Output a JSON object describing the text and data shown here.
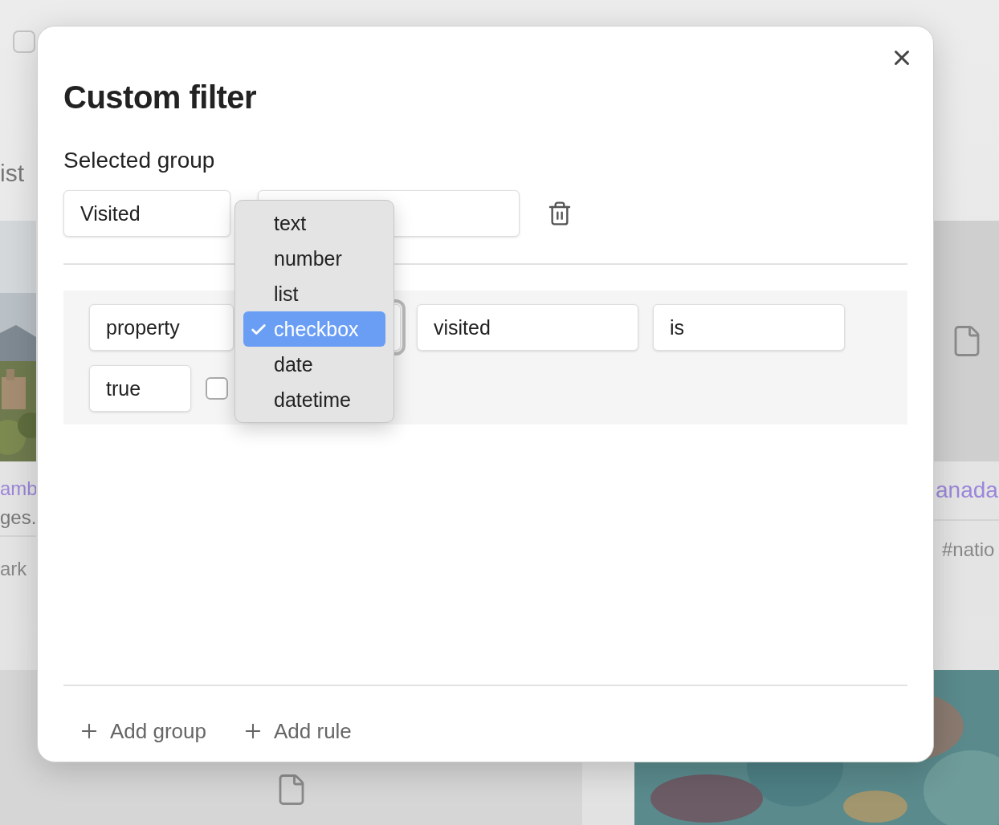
{
  "background": {
    "checkbox": {
      "checked": false
    },
    "header_text": "ist",
    "cards": [
      {
        "kind": "picture",
        "title": "amb",
        "description": "ges.",
        "tag": "ark"
      },
      {
        "kind": "file",
        "title": "anada",
        "tag": "#natio"
      }
    ],
    "bottom_cards": [
      {
        "kind": "file"
      },
      {
        "kind": "picture"
      }
    ]
  },
  "dialog": {
    "title": "Custom filter",
    "section_label": "Selected group",
    "group": {
      "name": "Visited"
    },
    "rule": {
      "source": "property",
      "type_focused": true,
      "property": "visited",
      "operator": "is",
      "value": "true",
      "checked": false
    },
    "type_menu": [
      {
        "label": "text",
        "selected": false
      },
      {
        "label": "number",
        "selected": false
      },
      {
        "label": "list",
        "selected": false
      },
      {
        "label": "checkbox",
        "selected": true
      },
      {
        "label": "date",
        "selected": false
      },
      {
        "label": "datetime",
        "selected": false
      }
    ],
    "actions": [
      {
        "label": "Add group"
      },
      {
        "label": "Add rule"
      }
    ]
  }
}
